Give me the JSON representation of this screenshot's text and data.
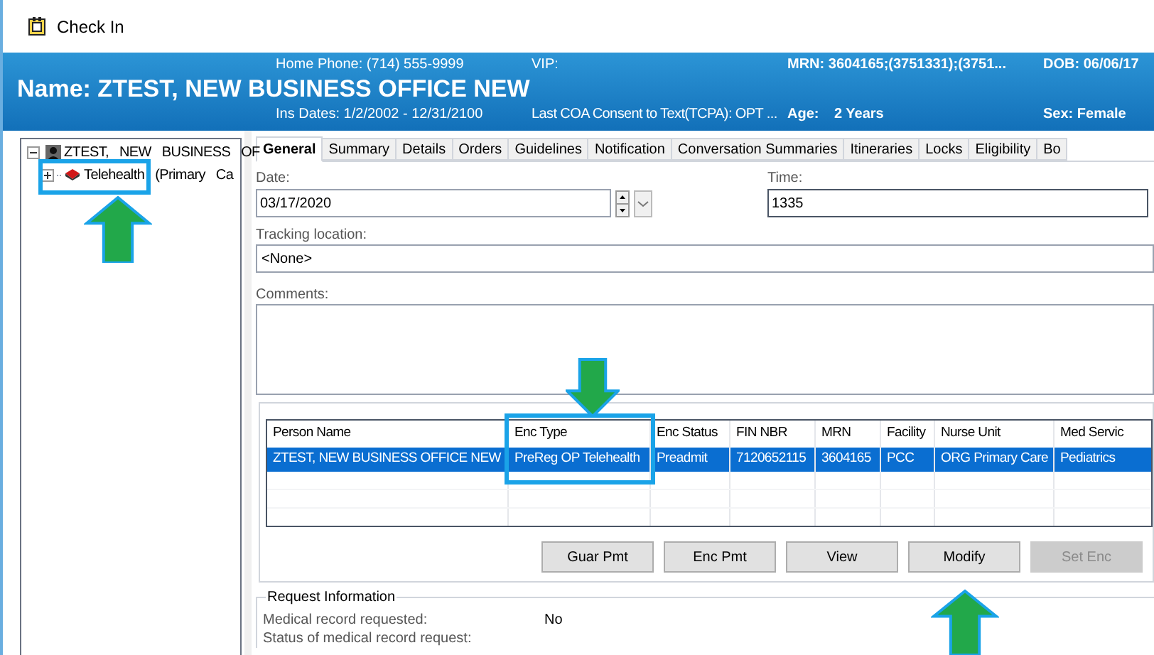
{
  "window": {
    "title": "Check In"
  },
  "header": {
    "name": "Name: ZTEST, NEW BUSINESS OFFICE NEW",
    "home_phone": "Home Phone: (714) 555-9999",
    "vip": "VIP:",
    "ins_dates": "Ins Dates: 1/2/2002 - 12/31/2100",
    "consent": "Last COA Consent to Text(TCPA): OPT ...",
    "mrn": "MRN: 3604165;(3751331);(3751...",
    "dob": "DOB: 06/06/17",
    "age_label": "Age:",
    "age": "2 Years",
    "sex": "Sex: Female"
  },
  "tree": [
    {
      "label": "ZTEST, NEW BUSINESS OF",
      "expanded": true,
      "kind": "person",
      "children": [
        {
          "label": "Telehealth (Primary Ca",
          "expanded": false,
          "kind": "encounter"
        }
      ]
    }
  ],
  "tabs": [
    {
      "label": "General",
      "selected": true
    },
    {
      "label": "Summary",
      "selected": false
    },
    {
      "label": "Details",
      "selected": false
    },
    {
      "label": "Orders",
      "selected": false
    },
    {
      "label": "Guidelines",
      "selected": false
    },
    {
      "label": "Notification",
      "selected": false
    },
    {
      "label": "Conversation Summaries",
      "selected": false
    },
    {
      "label": "Itineraries",
      "selected": false
    },
    {
      "label": "Locks",
      "selected": false
    },
    {
      "label": "Eligibility",
      "selected": false
    },
    {
      "label": "Bo",
      "selected": false
    }
  ],
  "form": {
    "date_label": "Date:",
    "date": "03/17/2020",
    "time_label": "Time:",
    "time": "1335",
    "tracking_label": "Tracking location:",
    "tracking": "<None>",
    "comments_label": "Comments:"
  },
  "table": {
    "columns": [
      "Person Name",
      "Enc Type",
      "Enc Status",
      "FIN NBR",
      "MRN",
      "Facility",
      "Nurse Unit",
      "Med Servic"
    ],
    "rows": [
      {
        "selected": true,
        "cells": [
          "ZTEST, NEW BUSINESS OFFICE NEW",
          "PreReg OP Telehealth",
          "Preadmit",
          "7120652115",
          "3604165",
          "PCC",
          "ORG Primary Care",
          "Pediatrics"
        ]
      }
    ]
  },
  "buttons": [
    {
      "label": "Guar Pmt",
      "disabled": false
    },
    {
      "label": "Enc Pmt",
      "disabled": false
    },
    {
      "label": "View",
      "disabled": false
    },
    {
      "label": "Modify",
      "disabled": false
    },
    {
      "label": "Set Enc",
      "disabled": true
    }
  ],
  "request_info": {
    "title": "Request Information",
    "rows": [
      {
        "label": "Medical record requested:",
        "value": "No"
      },
      {
        "label": "Status of medical record request:"
      }
    ]
  }
}
